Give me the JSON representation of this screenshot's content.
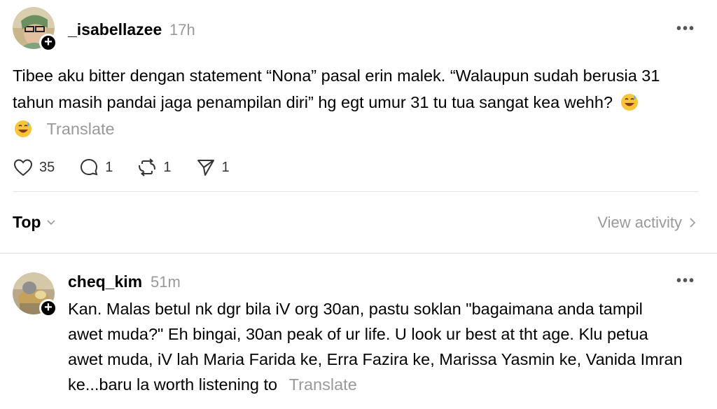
{
  "post": {
    "username": "_isabellazee",
    "time": "17h",
    "text_line1": "Tibee aku bitter dengan statement “Nona” pasal erin malek. “Walaupun sudah berusia 31",
    "text_line2": "tahun masih pandai jaga penampilan diri” hg egt umur 31 tu tua sangat kea wehh?",
    "translate": "Translate",
    "likes": "35",
    "replies": "1",
    "reposts": "1",
    "shares": "1",
    "more": "•••"
  },
  "replies_header": {
    "sort_label": "Top",
    "view_activity": "View activity"
  },
  "reply": {
    "username": "cheq_kim",
    "time": "51m",
    "line1": "Kan. Malas betul nk dgr bila iV org 30an, pastu soklan \"bagaimana anda tampil",
    "line2": "awet muda?\" Eh bingai, 30an peak of ur life. U look ur best at tht age. Klu petua",
    "line3": "awet muda, iV lah Maria Farida ke, Erra Fazira ke, Marissa Yasmin ke, Vanida Imran",
    "line4": "ke...baru la worth listening to",
    "translate": "Translate",
    "more": "•••"
  },
  "icons": {
    "like": "heart-icon",
    "reply": "comment-icon",
    "repost": "repost-icon",
    "share": "send-icon",
    "emoji": "grinning-sweat-emoji"
  },
  "colors": {
    "muted": "#999999",
    "divider": "#e5e5e5"
  }
}
